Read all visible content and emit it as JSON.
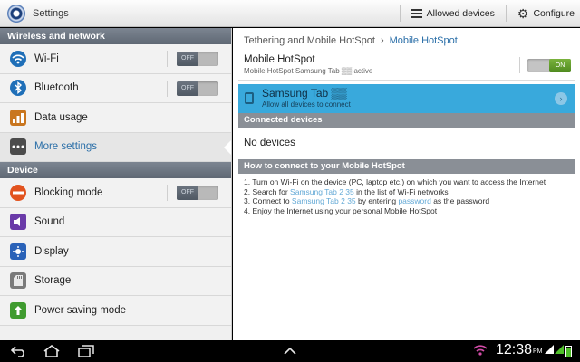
{
  "app": {
    "title": "Settings"
  },
  "actionbar": {
    "allowed_devices": "Allowed devices",
    "configure": "Configure"
  },
  "sections": {
    "wireless": "Wireless and network",
    "device": "Device"
  },
  "left_items": {
    "wifi": {
      "label": "Wi-Fi",
      "toggle": "OFF"
    },
    "bluetooth": {
      "label": "Bluetooth",
      "toggle": "OFF"
    },
    "data_usage": {
      "label": "Data usage"
    },
    "more_settings": {
      "label": "More settings"
    },
    "blocking_mode": {
      "label": "Blocking mode",
      "toggle": "OFF"
    },
    "sound": {
      "label": "Sound"
    },
    "display": {
      "label": "Display"
    },
    "storage": {
      "label": "Storage"
    },
    "power_saving": {
      "label": "Power saving mode"
    }
  },
  "breadcrumb": {
    "parent": "Tethering and Mobile HotSpot",
    "separator": "›",
    "current": "Mobile HotSpot"
  },
  "hotspot": {
    "title": "Mobile HotSpot",
    "subtitle": "Mobile HotSpot Samsung Tab ▒▒ active",
    "toggle": "ON"
  },
  "device_row": {
    "name": "Samsung Tab ▒▒",
    "sub": "Allow all devices to connect"
  },
  "connected": {
    "header": "Connected devices",
    "empty": "No devices"
  },
  "howto": {
    "header": "How to connect to your Mobile HotSpot",
    "line1": "1. Turn on Wi-Fi on the device (PC, laptop etc.) on which you want to access the Internet",
    "line2_pre": "2. Search for ",
    "line2_hl": "Samsung Tab 2 35",
    "line2_post": " in the list of Wi-Fi networks",
    "line3_pre": "3. Connect to ",
    "line3_hl1": "Samsung Tab 2 35",
    "line3_mid": " by entering ",
    "line3_hl2": "password",
    "line3_post": " as the password",
    "line4": "4. Enjoy the Internet using your personal Mobile HotSpot"
  },
  "statusbar": {
    "time": "12:38",
    "ampm": "PM"
  },
  "colors": {
    "accent": "#2b6fa8",
    "highlight": "#39a9dc",
    "on_toggle": "#5a9a25",
    "section_header": "#6c7581"
  },
  "icons": {
    "app": "settings-icon",
    "menu": "menu-icon",
    "gear": "gear-icon",
    "wifi": "wifi-icon",
    "bluetooth": "bluetooth-icon",
    "data_usage": "chart-icon",
    "more": "more-icon",
    "blocking": "minus-circle-icon",
    "sound": "speaker-icon",
    "display": "display-icon",
    "storage": "sd-card-icon",
    "power": "recycle-icon",
    "back": "back-icon",
    "home": "home-icon",
    "recent": "recent-apps-icon"
  }
}
